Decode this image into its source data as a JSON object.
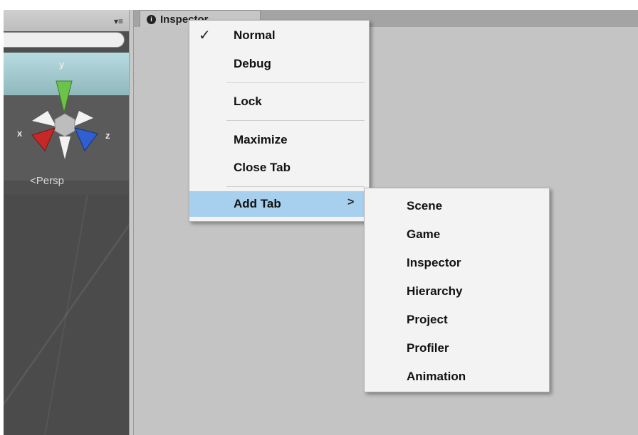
{
  "scene": {
    "axis_x": "x",
    "axis_y": "y",
    "axis_z": "z",
    "perspective_label": "<Persp",
    "panel_menu_icon": "▾≡"
  },
  "inspector_tab": {
    "label": "Inspector",
    "icon": "info-icon"
  },
  "context_menu": {
    "items": [
      {
        "label": "Normal",
        "checked": true
      },
      {
        "label": "Debug"
      },
      {
        "label": "Lock"
      },
      {
        "label": "Maximize"
      },
      {
        "label": "Close Tab"
      },
      {
        "label": "Add Tab",
        "submenu_arrow": ">",
        "highlighted": true
      }
    ]
  },
  "add_tab_submenu": {
    "items": [
      "Scene",
      "Game",
      "Inspector",
      "Hierarchy",
      "Project",
      "Profiler",
      "Animation"
    ]
  },
  "colors": {
    "highlight": "#a6d0ee",
    "gizmo_y": "#6cc34a",
    "gizmo_x": "#c62828",
    "gizmo_z": "#2f5fd0"
  }
}
